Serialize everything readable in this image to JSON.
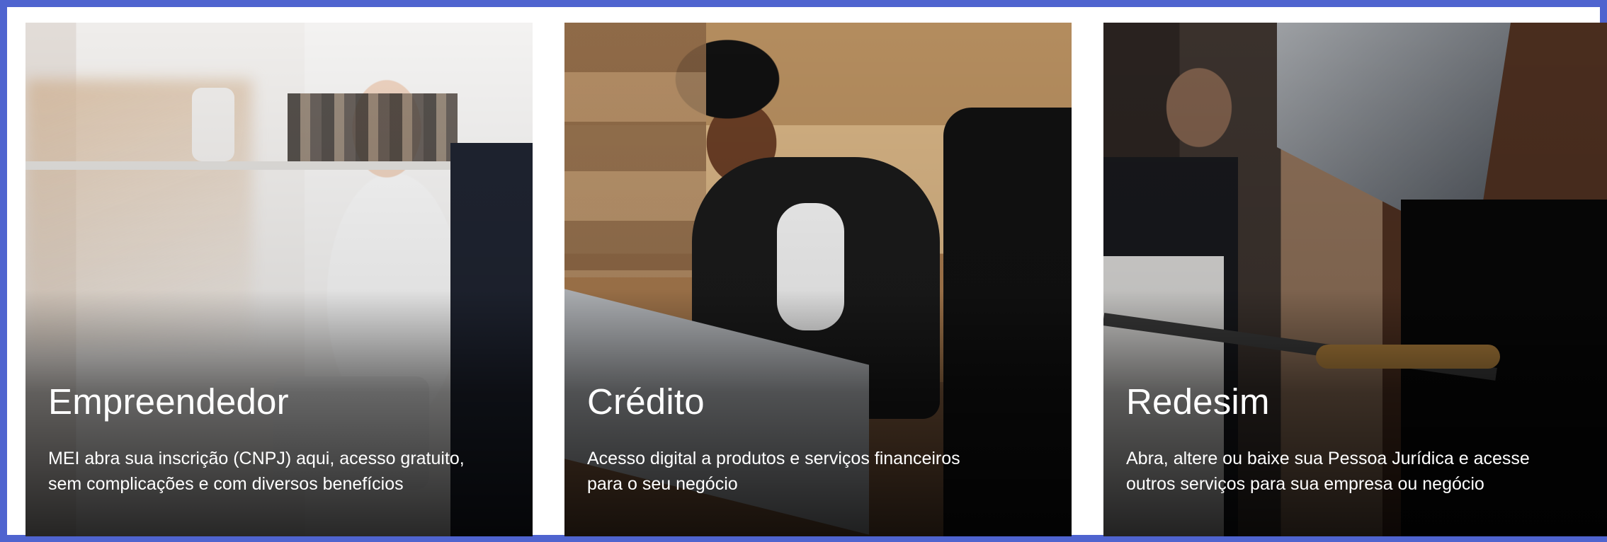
{
  "cards": [
    {
      "title": "Empreendedor",
      "description_line_1": "MEI abra sua inscrição (CNPJ) aqui, acesso gratuito,",
      "description_line_2": "sem complicações e com diversos benefícios"
    },
    {
      "title": "Crédito",
      "description_line_1": "Acesso digital a produtos e serviços financeiros",
      "description_line_2": "para o seu negócio"
    },
    {
      "title": "Redesim",
      "description_line_1": "Abra, altere ou baixe sua Pessoa Jurídica e acesse",
      "description_line_2": "outros serviços para sua empresa ou negócio"
    }
  ],
  "colors": {
    "frame_border": "#4f64cf",
    "text": "#ffffff"
  }
}
